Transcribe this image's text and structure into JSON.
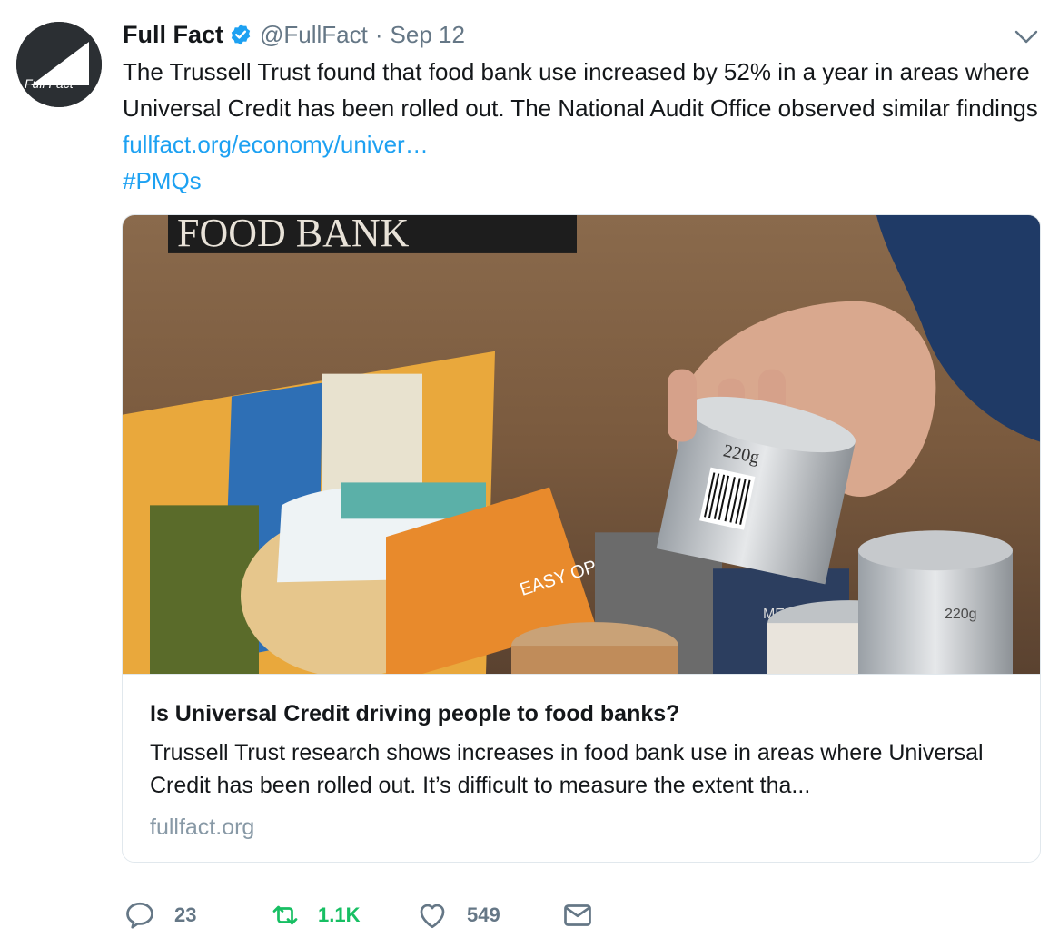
{
  "tweet": {
    "author_name": "Full Fact",
    "handle": "@FullFact",
    "separator": "·",
    "date": "Sep 12",
    "avatar_text": "Full Fact",
    "text_main": "The Trussell Trust found that food bank use increased by 52% in a year in areas where Universal Credit has been rolled out. The National Audit Office observed similar findings ",
    "link_text": "fullfact.org/economy/univer…",
    "hashtag": "#PMQs"
  },
  "card": {
    "image_sign_text": "FOOD BANK",
    "image_pack_text": "EASY OPEN",
    "image_can_text": "220g",
    "image_brand_text": "MERCHA",
    "title": "Is Universal Credit driving people to food banks?",
    "description": "Trussell Trust research shows increases in food bank use in areas where Universal Credit has been rolled out. It’s difficult to measure the extent tha...",
    "domain": "fullfact.org"
  },
  "actions": {
    "replies": "23",
    "retweets": "1.1K",
    "likes": "549"
  },
  "colors": {
    "link": "#1da1f2",
    "retweet": "#17bf63",
    "muted": "#657786"
  }
}
